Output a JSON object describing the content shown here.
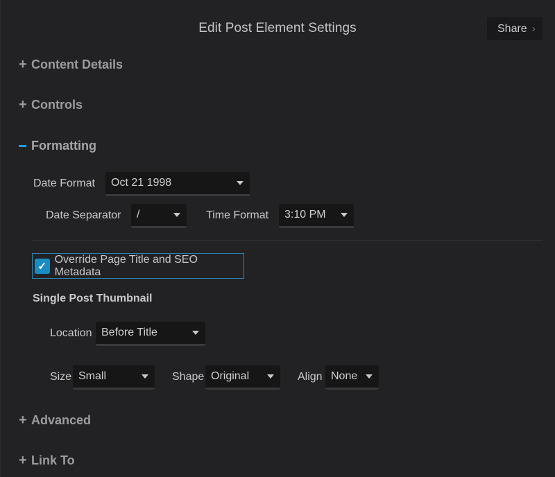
{
  "header": {
    "title": "Edit Post Element Settings",
    "share_label": "Share",
    "share_chevron": "›"
  },
  "sections": {
    "content_details": {
      "symbol": "+",
      "label": "Content Details",
      "expanded": false
    },
    "controls": {
      "symbol": "+",
      "label": "Controls",
      "expanded": false
    },
    "formatting": {
      "symbol": "−",
      "label": "Formatting",
      "expanded": true
    },
    "advanced": {
      "symbol": "+",
      "label": "Advanced",
      "expanded": false
    },
    "link_to": {
      "symbol": "+",
      "label": "Link To",
      "expanded": false
    }
  },
  "formatting": {
    "date_format": {
      "label": "Date Format",
      "value": "Oct 21 1998"
    },
    "date_separator": {
      "label": "Date Separator",
      "value": "/"
    },
    "time_format": {
      "label": "Time Format",
      "value": "3:10 PM"
    },
    "override": {
      "label": "Override Page Title and SEO Metadata",
      "checked": true,
      "check_glyph": "✓"
    },
    "thumbnail": {
      "heading": "Single Post Thumbnail",
      "location": {
        "label": "Location",
        "value": "Before Title"
      },
      "size": {
        "label": "Size",
        "value": "Small"
      },
      "shape": {
        "label": "Shape",
        "value": "Original"
      },
      "align": {
        "label": "Align",
        "value": "None"
      }
    }
  },
  "colors": {
    "background": "#222224",
    "accent": "#1c9fd3",
    "checkbox": "#1a8cc4",
    "select_bg": "#161617"
  }
}
